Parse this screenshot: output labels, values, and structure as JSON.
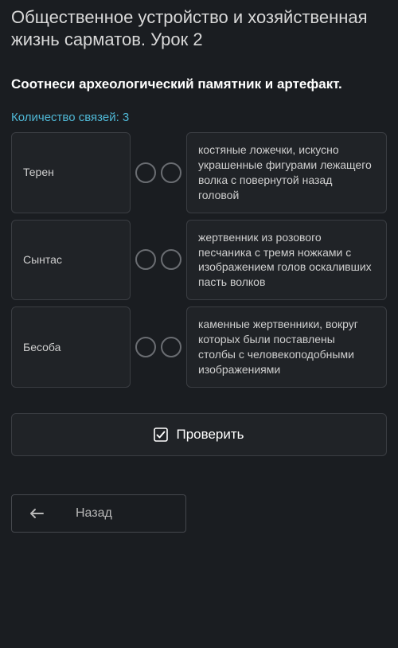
{
  "title": "Общественное устройство и хозяйственная жизнь сарматов. Урок 2",
  "instruction": "Соотнеси археологический памятник и артефакт.",
  "count_label": "Количество связей: 3",
  "pairs": {
    "left": [
      "Терен",
      "Сынтас",
      "Бесоба"
    ],
    "right": [
      "костяные ложечки, искусно украшенные фигурами лежащего волка с повернутой назад головой",
      "жертвенник из розового песчаника с тремя ножками с изображением голов оскаливших пасть волков",
      "каменные жертвенники, вокруг которых были поставлены столбы с человекоподобными изображениями"
    ]
  },
  "buttons": {
    "check": "Проверить",
    "back": "Назад"
  }
}
